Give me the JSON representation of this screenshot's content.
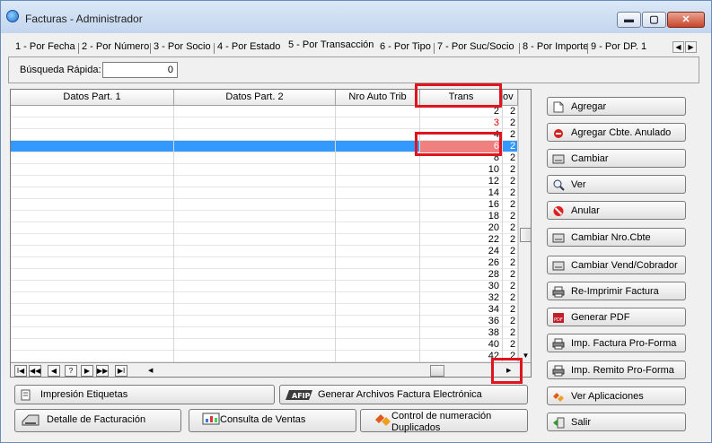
{
  "window": {
    "title": "Facturas -  Administrador",
    "min_glyph": "▬",
    "max_glyph": "▢",
    "close_glyph": "✕"
  },
  "tabs": [
    {
      "label": "1 - Por Fecha"
    },
    {
      "label": "2 - Por Número"
    },
    {
      "label": "3 - Por Socio"
    },
    {
      "label": "4 - Por Estado"
    },
    {
      "label": "5 - Por Transacción",
      "active": true
    },
    {
      "label": "6 - Por Tipo"
    },
    {
      "label": "7 - Por Suc/Socio"
    },
    {
      "label": "8 - Por Importe"
    },
    {
      "label": "9 - Por DP. 1"
    }
  ],
  "tab_scroll": {
    "left": "◀",
    "right": "▶"
  },
  "search": {
    "label": "Búsqueda Rápida:",
    "value": "0"
  },
  "grid": {
    "columns": [
      "Datos Part. 1",
      "Datos Part. 2",
      "Nro Auto Trib",
      "Trans",
      "ov"
    ],
    "rows": [
      {
        "trans": "2",
        "prov": "2",
        "color": "#000000"
      },
      {
        "trans": "3",
        "prov": "2",
        "color": "#e00000"
      },
      {
        "trans": "4",
        "prov": "2",
        "color": "#000000"
      },
      {
        "trans": "6",
        "prov": "2",
        "color": "#ffffff",
        "selected": true
      },
      {
        "trans": "8",
        "prov": "2",
        "color": "#000000"
      },
      {
        "trans": "10",
        "prov": "2",
        "color": "#000000"
      },
      {
        "trans": "12",
        "prov": "2",
        "color": "#000000"
      },
      {
        "trans": "14",
        "prov": "2",
        "color": "#000000"
      },
      {
        "trans": "16",
        "prov": "2",
        "color": "#000000"
      },
      {
        "trans": "18",
        "prov": "2",
        "color": "#000000"
      },
      {
        "trans": "20",
        "prov": "2",
        "color": "#000000"
      },
      {
        "trans": "22",
        "prov": "2",
        "color": "#000000"
      },
      {
        "trans": "24",
        "prov": "2",
        "color": "#000000"
      },
      {
        "trans": "26",
        "prov": "2",
        "color": "#000000"
      },
      {
        "trans": "28",
        "prov": "2",
        "color": "#000000"
      },
      {
        "trans": "30",
        "prov": "2",
        "color": "#000000"
      },
      {
        "trans": "32",
        "prov": "2",
        "color": "#000000"
      },
      {
        "trans": "34",
        "prov": "2",
        "color": "#000000"
      },
      {
        "trans": "36",
        "prov": "2",
        "color": "#000000"
      },
      {
        "trans": "38",
        "prov": "2",
        "color": "#000000"
      },
      {
        "trans": "40",
        "prov": "2",
        "color": "#000000"
      },
      {
        "trans": "42",
        "prov": "2",
        "color": "#000000"
      }
    ]
  },
  "navigator": {
    "first": "I◀",
    "prev_page": "◀◀",
    "prev": "◀",
    "help": "?",
    "next": "▶",
    "next_page": "▶▶",
    "last": "▶I",
    "scroll_left": "◀",
    "scroll_right": "▶",
    "scroll_down": "▼"
  },
  "side_buttons": [
    {
      "label": "Agregar",
      "icon": "new-document-icon"
    },
    {
      "label": "Agregar Cbte. Anulado",
      "icon": "red-minus-icon"
    },
    {
      "label": "Cambiar",
      "icon": "edit-icon"
    },
    {
      "label": "Ver",
      "icon": "magnifier-icon"
    },
    {
      "label": "Anular",
      "icon": "cancel-icon"
    },
    {
      "label": "Cambiar Nro.Cbte",
      "icon": "edit-icon"
    },
    {
      "label": "Cambiar Vend/Cobrador",
      "icon": "edit-icon"
    },
    {
      "label": "Re-Imprimir Factura",
      "icon": "printer-icon"
    },
    {
      "label": "Generar PDF",
      "icon": "pdf-icon"
    },
    {
      "label": "Imp. Factura Pro-Forma",
      "icon": "printer-icon"
    },
    {
      "label": "Imp. Remito Pro-Forma",
      "icon": "printer-icon"
    },
    {
      "label": "Ver Aplicaciones",
      "icon": "apps-icon"
    },
    {
      "label": "Salir",
      "icon": "exit-icon"
    }
  ],
  "bottom_buttons": {
    "labels": "Impresión Etiquetas",
    "efact": "Generar Archivos Factura Electrónica",
    "efact_logo": "AFIP",
    "detalle": "Detalle de Facturación",
    "consulta": "Consulta de Ventas",
    "control": "Control de numeración Duplicados"
  },
  "colors": {
    "selection": "#3399ff",
    "highlight": "#e0141e",
    "red_text": "#e00000",
    "selected_cell": "#f08080"
  }
}
